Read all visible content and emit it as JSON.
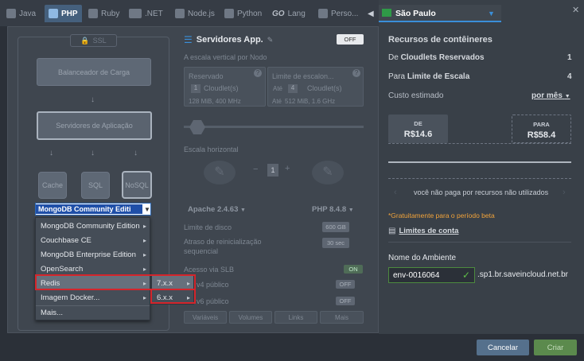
{
  "tabs": [
    {
      "label": "Java",
      "icon": "java-icon"
    },
    {
      "label": "PHP",
      "icon": "php-icon"
    },
    {
      "label": "Ruby",
      "icon": "ruby-icon"
    },
    {
      "label": ".NET",
      "icon": "dotnet-icon"
    },
    {
      "label": "Node.js",
      "icon": "nodejs-icon"
    },
    {
      "label": "Python",
      "icon": "python-icon"
    },
    {
      "label": "Lang",
      "prefix": "GO",
      "icon": "go-icon"
    },
    {
      "label": "Perso...",
      "icon": "custom-icon"
    }
  ],
  "tabs_scroll": "◀",
  "diagram": {
    "ssl": "SSL",
    "load_balancer": "Balanceador de Carga",
    "app_servers": "Servidores de Aplicação",
    "cache": "Cache",
    "sql": "SQL",
    "nosql": "NoSQL",
    "selected_db": "MongoDB Community Editi",
    "menu": [
      {
        "label": "MongoDB Community Edition",
        "arrow": "▸"
      },
      {
        "label": "Couchbase CE",
        "arrow": "▸"
      },
      {
        "label": "MongoDB Enterprise Edition",
        "arrow": "▸"
      },
      {
        "label": "OpenSearch",
        "arrow": "▸"
      },
      {
        "label": "Redis",
        "arrow": "▸"
      },
      {
        "label": "Imagem Docker...",
        "arrow": "▸"
      },
      {
        "label": "Mais...",
        "arrow": ""
      }
    ],
    "submenu": [
      {
        "label": "7.x.x",
        "arrow": "▸"
      },
      {
        "label": "6.x.x",
        "arrow": "▸"
      }
    ]
  },
  "config": {
    "title": "Servidores App.",
    "toggle_off": "OFF",
    "vertical_scaling": "A escala vertical por Nodo",
    "reserved": "Reservado",
    "reserved_value": "1",
    "cloudlets": "Cloudlet(s)",
    "reserved_info": "128 MiB, 400 MHz",
    "limit": "Limite de escalon...",
    "limit_prefix": "Até",
    "limit_value": "4",
    "limit_info_prefix": "Até",
    "limit_info": "512 MiB, 1.6 GHz",
    "horizontal_scaling": "Escala horizontal",
    "node_count": "1",
    "minus": "−",
    "plus": "+",
    "apache": "Apache 2.4.63",
    "php": "PHP 8.4.8",
    "disk_limit": "Limite de disco",
    "disk_value": "600 GB",
    "restart_delay_1": "Atraso de reinicialização",
    "restart_delay_2": "sequencial",
    "restart_value": "30 sec",
    "slb": "Acesso via SLB",
    "on": "ON",
    "ipv4": "v4 público",
    "ipv6": "v6 público",
    "off": "OFF",
    "bottom_buttons": [
      "Variáveis",
      "Volumes",
      "Links",
      "Mais"
    ]
  },
  "region": {
    "label": "São Paulo",
    "close": "✕"
  },
  "resources": {
    "title": "Recursos de contêineres",
    "reserved_prefix": "De ",
    "reserved_bold": "Cloudlets Reservados",
    "reserved_value": "1",
    "limit_prefix": "Para ",
    "limit_bold": "Limite de Escala",
    "limit_value": "4",
    "cost_label": "Custo estimado",
    "cost_period": "por mês",
    "from_label": "DE",
    "from_value": "R$14.6",
    "to_label": "PARA",
    "to_value": "R$58.4",
    "unused_note": "você não paga por recursos não utilizados",
    "free_note": "*Gratuitamente para o período beta",
    "account_limits": "Limites de conta"
  },
  "env": {
    "label": "Nome do Ambiente",
    "name": "env-0016064",
    "domain": ".sp1.br.saveincloud.net.br"
  },
  "footer": {
    "cancel": "Cancelar",
    "create": "Criar"
  },
  "colors": {
    "accent": "#3a8fd9",
    "highlight": "#d4252b",
    "create": "#5b8a4d",
    "cancel": "#55708c"
  }
}
